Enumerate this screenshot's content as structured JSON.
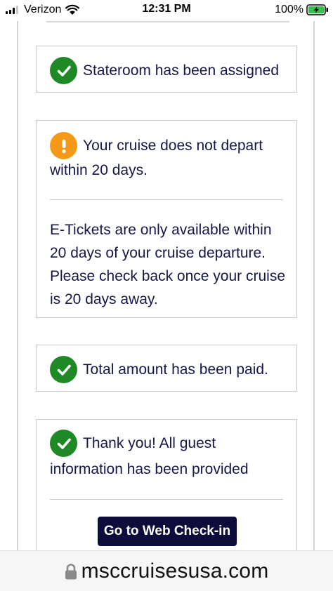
{
  "status_bar": {
    "carrier": "Verizon",
    "time": "12:31 PM",
    "battery_percent": "100%",
    "signal_bars_filled": 3,
    "signal_bars_total": 4
  },
  "cards": {
    "stateroom": {
      "icon": "check-circle-icon",
      "text": "Stateroom has been assigned"
    },
    "departure": {
      "icon": "exclamation-circle-icon",
      "text_line1": "Your cruise does not depart",
      "text_line2": "within 20 days.",
      "detail": " E-Tickets are only available within 20 days of your cruise departure. Please check back once your cruise is 20 days away."
    },
    "payment": {
      "icon": "check-circle-icon",
      "text": "Total amount has been paid."
    },
    "guest_info": {
      "icon": "check-circle-icon",
      "text_line1": "Thank you! All guest",
      "text_line2": "information has been provided",
      "button_label": "Go to Web Check-in"
    }
  },
  "browser": {
    "domain": "msccruisesusa.com",
    "lock_icon": "lock-icon"
  },
  "colors": {
    "success": "#1f8a25",
    "warning": "#f59a18",
    "text": "#15164a",
    "button": "#0c0d3a"
  }
}
